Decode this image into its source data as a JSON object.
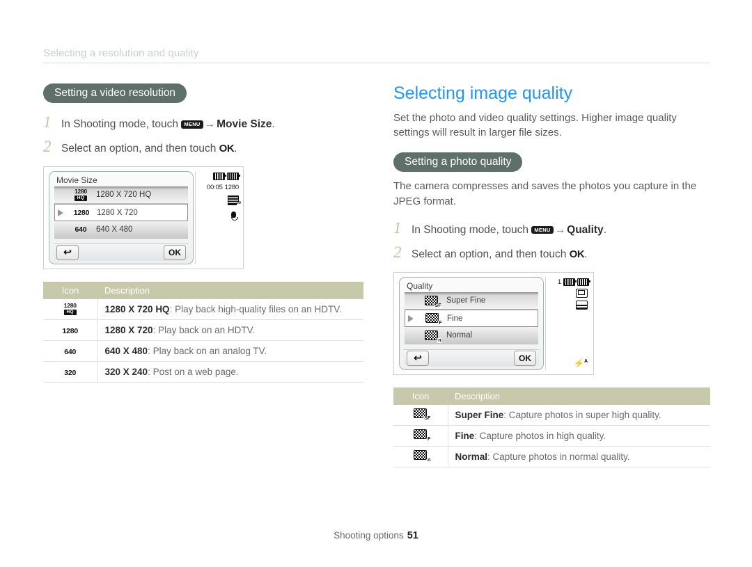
{
  "running_header": "Selecting a resolution and quality",
  "left": {
    "section_badge": "Setting a video resolution",
    "steps": [
      {
        "num": "1",
        "pre": "In Shooting mode, touch ",
        "chip": "MENU",
        "arrow": "→",
        "bold": "Movie Size",
        "post": "."
      },
      {
        "num": "2",
        "pre": "Select an option, and then touch ",
        "chip": null,
        "bold": null,
        "ok": "OK",
        "post": "."
      }
    ],
    "camera": {
      "title": "Movie Size",
      "options": [
        {
          "icon": "1280-hq-icon",
          "icon_top": "1280",
          "icon_bot": "HQ",
          "label": "1280 X 720 HQ",
          "selected": false
        },
        {
          "icon": "1280-icon",
          "icon_top": "1280",
          "icon_bot": null,
          "label": "1280 X 720",
          "selected": true
        },
        {
          "icon": "640-icon",
          "icon_top": "640",
          "icon_bot": null,
          "label": "640 X 480",
          "selected": false
        }
      ],
      "back_label": "↩",
      "ok_label": "OK",
      "status": {
        "time": "00:05",
        "resolution": "1280",
        "fps": "30"
      }
    },
    "table": {
      "headers": [
        "Icon",
        "Description"
      ],
      "rows": [
        {
          "icon_top": "1280",
          "icon_bot": "HQ",
          "term": "1280 X 720 HQ",
          "desc": ": Play back high-quality files on an HDTV."
        },
        {
          "icon_top": "1280",
          "icon_bot": null,
          "term": "1280 X 720",
          "desc": ": Play back on an HDTV."
        },
        {
          "icon_top": "640",
          "icon_bot": null,
          "term": "640 X 480",
          "desc": ": Play back on an analog TV."
        },
        {
          "icon_top": "320",
          "icon_bot": null,
          "term": "320 X 240",
          "desc": ": Post on a web page."
        }
      ]
    }
  },
  "right": {
    "title": "Selecting image quality",
    "intro": "Set the photo and video quality settings. Higher image quality settings will result in larger file sizes.",
    "section_badge": "Setting a photo quality",
    "subintro": "The camera compresses and saves the photos you capture in the JPEG format.",
    "steps": [
      {
        "num": "1",
        "pre": "In Shooting mode, touch ",
        "chip": "MENU",
        "arrow": "→",
        "bold": "Quality",
        "post": "."
      },
      {
        "num": "2",
        "pre": "Select an option, and then touch ",
        "chip": null,
        "bold": null,
        "ok": "OK",
        "post": "."
      }
    ],
    "camera": {
      "title": "Quality",
      "options": [
        {
          "icon": "quality-superfine-icon",
          "sub": "SF",
          "label": "Super Fine",
          "selected": false
        },
        {
          "icon": "quality-fine-icon",
          "sub": "F",
          "label": "Fine",
          "selected": true
        },
        {
          "icon": "quality-normal-icon",
          "sub": "n",
          "label": "Normal",
          "selected": false
        }
      ],
      "back_label": "↩",
      "ok_label": "OK",
      "status": {
        "count": "1",
        "flash": "A"
      }
    },
    "table": {
      "headers": [
        "Icon",
        "Description"
      ],
      "rows": [
        {
          "sub": "SF",
          "term": "Super Fine",
          "desc": ": Capture photos in super high quality."
        },
        {
          "sub": "F",
          "term": "Fine",
          "desc": ": Capture photos in high quality."
        },
        {
          "sub": "n",
          "term": "Normal",
          "desc": ": Capture photos in normal quality."
        }
      ]
    }
  },
  "footer": {
    "label": "Shooting options",
    "page": "51"
  },
  "colors": {
    "heading_blue": "#2196f3",
    "pill_bg": "#5f6f6a",
    "table_header": "#c8c8ab",
    "step_number": "#b6cc9e",
    "running_header": "#c6d2c8"
  }
}
